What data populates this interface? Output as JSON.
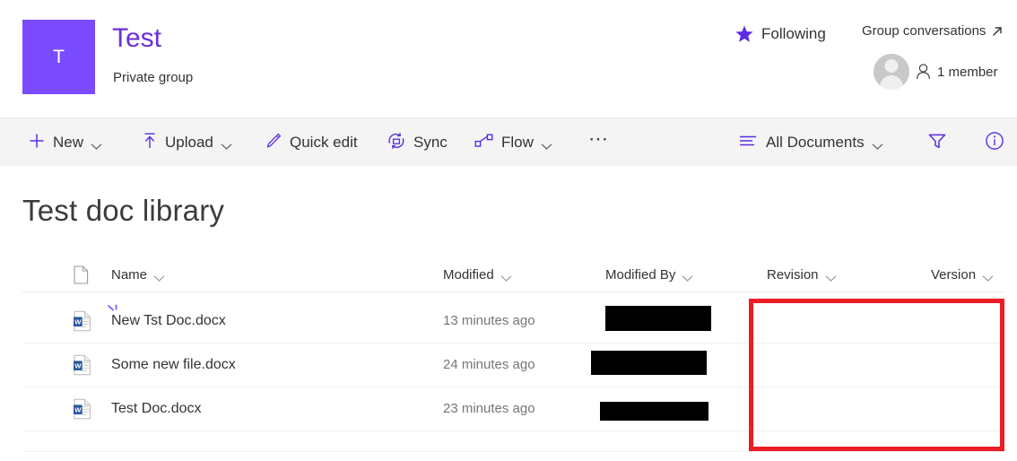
{
  "header": {
    "logo_letter": "T",
    "group_name": "Test",
    "group_type": "Private group",
    "following_label": "Following",
    "group_conversations_label": "Group conversations",
    "member_count_label": "1 member",
    "accent_color": "#7B4BFF",
    "title_color": "#6B2FD6"
  },
  "command_bar": {
    "items": [
      {
        "label": "New",
        "icon": "plus-icon",
        "has_chevron": true
      },
      {
        "label": "Upload",
        "icon": "upload-icon",
        "has_chevron": true
      },
      {
        "label": "Quick edit",
        "icon": "pencil-icon",
        "has_chevron": false
      },
      {
        "label": "Sync",
        "icon": "sync-icon",
        "has_chevron": false
      },
      {
        "label": "Flow",
        "icon": "flow-icon",
        "has_chevron": true
      },
      {
        "label": "",
        "icon": "more-icon",
        "has_chevron": false
      }
    ],
    "view_label": "All Documents",
    "filter_icon": "filter-icon",
    "info_icon": "info-icon",
    "icon_color": "#5B2BE5"
  },
  "library": {
    "title": "Test doc library",
    "columns": [
      {
        "label": "Name"
      },
      {
        "label": "Modified"
      },
      {
        "label": "Modified By"
      },
      {
        "label": "Revision"
      },
      {
        "label": "Version"
      }
    ],
    "rows": [
      {
        "name": "New Tst Doc.docx",
        "modified": "13 minutes ago",
        "modified_by": "",
        "revision": "",
        "version": "",
        "is_new": true,
        "file_type": "word"
      },
      {
        "name": "Some new file.docx",
        "modified": "24 minutes ago",
        "modified_by": "",
        "revision": "",
        "version": "",
        "is_new": false,
        "file_type": "word"
      },
      {
        "name": "Test Doc.docx",
        "modified": "23 minutes ago",
        "modified_by": "",
        "revision": "",
        "version": "",
        "is_new": false,
        "file_type": "word"
      }
    ]
  },
  "annotation": {
    "highlight_color": "#ED1C24"
  }
}
